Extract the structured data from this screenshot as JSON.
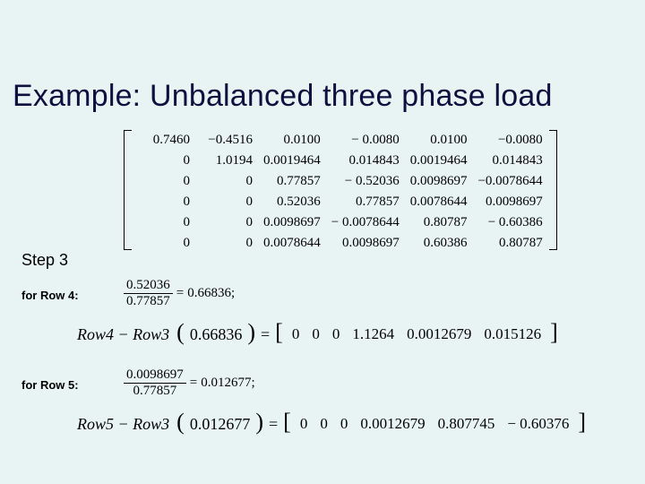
{
  "title": "Example: Unbalanced three phase load",
  "matrix": {
    "rows": [
      [
        "0.7460",
        "−0.4516",
        "0.0100",
        "− 0.0080",
        "0.0100",
        "−0.0080"
      ],
      [
        "0",
        "1.0194",
        "0.0019464",
        "0.014843",
        "0.0019464",
        "0.014843"
      ],
      [
        "0",
        "0",
        "0.77857",
        "− 0.52036",
        "0.0098697",
        "−0.0078644"
      ],
      [
        "0",
        "0",
        "0.52036",
        "0.77857",
        "0.0078644",
        "0.0098697"
      ],
      [
        "0",
        "0",
        "0.0098697",
        "− 0.0078644",
        "0.80787",
        "− 0.60386"
      ],
      [
        "0",
        "0",
        "0.0078644",
        "0.0098697",
        "0.60386",
        "0.80787"
      ]
    ]
  },
  "step_label": "Step 3",
  "labels": {
    "for_row4": "for Row 4:",
    "for_row5": "for Row 5:"
  },
  "ratio4": {
    "num": "0.52036",
    "den": "0.77857",
    "result": "0.66836;"
  },
  "ratio5": {
    "num": "0.0098697",
    "den": "0.77857",
    "result": "0.012677;"
  },
  "result_row4": {
    "lhs_prefix": "Row4 − Row3",
    "factor": "0.66836",
    "vec": [
      "0",
      "0",
      "0",
      "1.1264",
      "0.0012679",
      "0.015126"
    ]
  },
  "result_row5": {
    "lhs_prefix": "Row5 − Row3",
    "factor": "0.012677",
    "vec": [
      "0",
      "0",
      "0",
      "0.0012679",
      "0.807745",
      "− 0.60376"
    ]
  }
}
